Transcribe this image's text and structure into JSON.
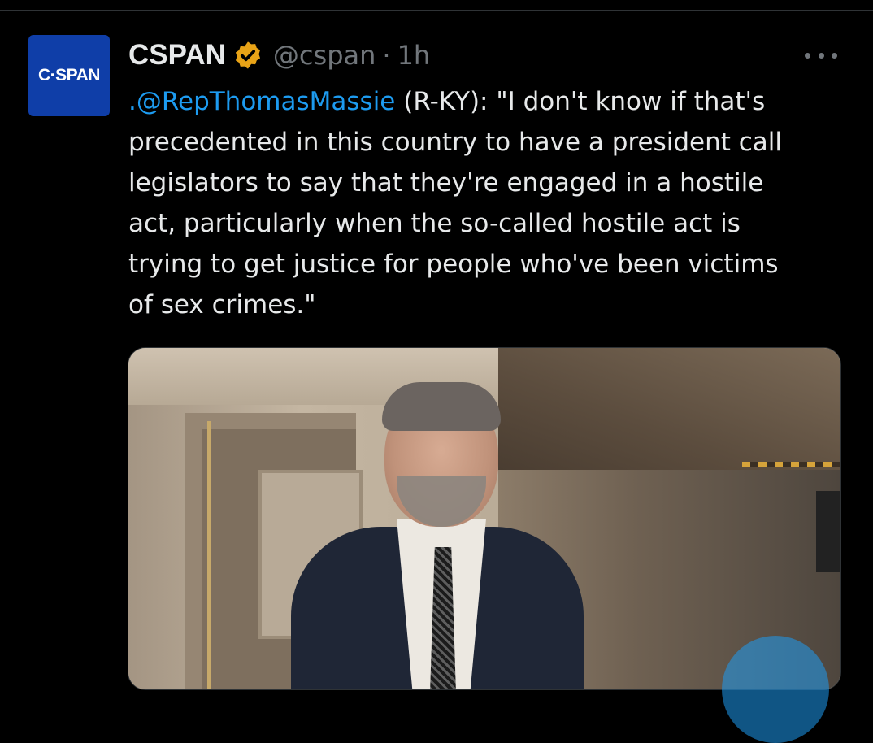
{
  "author": {
    "avatar_text": "C·SPAN",
    "name": "CSPAN",
    "handle": "@cspan",
    "separator": "·",
    "time": "1h",
    "verified_badge_color": "#e8a317"
  },
  "tweet": {
    "lines": [
      {
        "mention": ".@RepThomasMassie",
        "rest": " (R-KY): \"I don't know if that's"
      },
      {
        "text": "precedented in this country to have a president call"
      },
      {
        "text": "legislators to say that they're engaged in a hostile"
      },
      {
        "text": "act, particularly when the so-called hostile act is"
      },
      {
        "text": "trying to get justice for people who've been victims"
      },
      {
        "text": "of sex crimes.\""
      }
    ]
  },
  "icons": {
    "more": "more-horizontal-icon",
    "verified": "verified-badge-icon",
    "play": "play-icon"
  },
  "colors": {
    "background": "#000000",
    "text": "#e7e9ea",
    "secondary": "#71767b",
    "link": "#1d9bf0",
    "avatar_bg": "#0f3ea8"
  }
}
